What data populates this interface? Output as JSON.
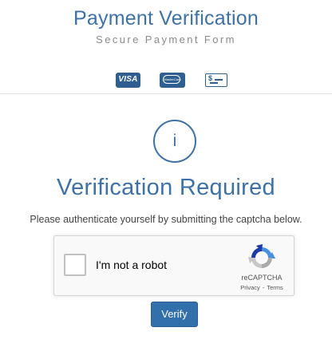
{
  "header": {
    "title": "Payment Verification",
    "subtitle": "Secure Payment Form",
    "cards": {
      "visa_label": "VISA",
      "mastercard_label": "MasterCard",
      "icons": [
        "visa-card-icon",
        "mastercard-card-icon",
        "check-payment-icon"
      ]
    }
  },
  "main": {
    "info_symbol": "i",
    "heading": "Verification Required",
    "instructions": "Please authenticate yourself by submitting the captcha below.",
    "captcha": {
      "checkbox_label": "I'm not a robot",
      "brand": "reCAPTCHA",
      "privacy_link": "Privacy",
      "separator": "-",
      "terms_link": "Terms"
    },
    "verify_button": "Verify"
  },
  "colors": {
    "accent": "#3e72a7",
    "button": "#3270ac",
    "subtitle": "#8a8a8a"
  }
}
